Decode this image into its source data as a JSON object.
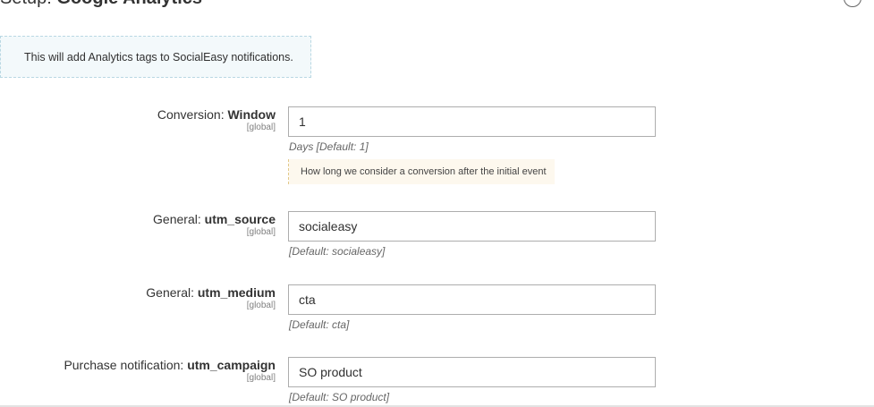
{
  "header": {
    "title_prefix": "Setup:",
    "title_name": "Google Analytics",
    "close_icon": "close-icon"
  },
  "notice": {
    "text": "This will add Analytics tags to SocialEasy notifications."
  },
  "fields": [
    {
      "label_prefix": "Conversion:",
      "label_name": "Window",
      "scope": "[global]",
      "value": "1",
      "note": "Days [Default: 1]",
      "tooltip": "How long we consider a conversion after the initial event"
    },
    {
      "label_prefix": "General:",
      "label_name": "utm_source",
      "scope": "[global]",
      "value": "socialeasy",
      "note": "[Default: socialeasy]"
    },
    {
      "label_prefix": "General:",
      "label_name": "utm_medium",
      "scope": "[global]",
      "value": "cta",
      "note": "[Default: cta]"
    },
    {
      "label_prefix": "Purchase notification:",
      "label_name": "utm_campaign",
      "scope": "[global]",
      "value": "SO product",
      "note": "[Default: SO product]"
    }
  ]
}
